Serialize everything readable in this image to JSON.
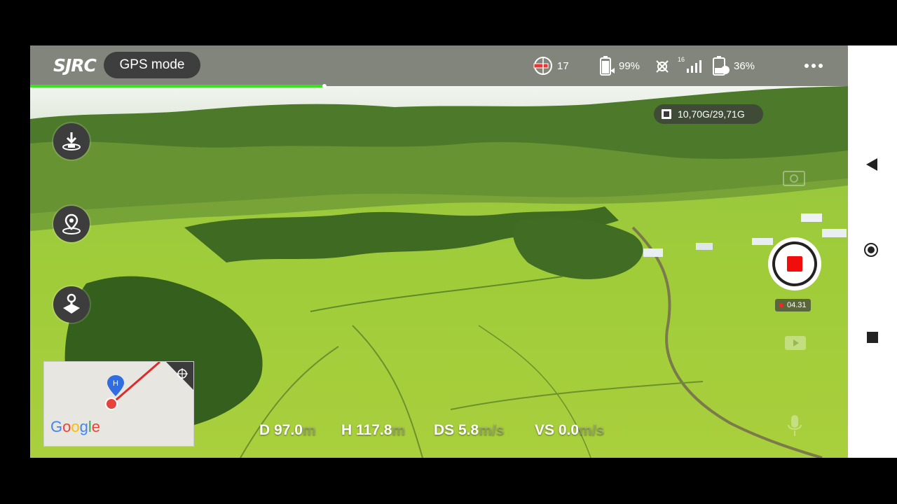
{
  "app": {
    "logo": "SJRC",
    "mode": "GPS mode"
  },
  "status": {
    "satellites": "17",
    "drone_battery": "99%",
    "signal_count": "16",
    "phone_battery": "36%"
  },
  "flight_progress": 0.36,
  "storage": "10,70G/29,71G",
  "side_buttons": [
    {
      "icon": "takeoff-landing-icon"
    },
    {
      "icon": "return-home-icon"
    },
    {
      "icon": "joystick-icon"
    }
  ],
  "minimap": {
    "brand": [
      "G",
      "o",
      "o",
      "g",
      "l",
      "e"
    ],
    "brand_colors": [
      "#4285F4",
      "#EA4335",
      "#FBBC05",
      "#4285F4",
      "#34A853",
      "#EA4335"
    ],
    "home_marker": "H"
  },
  "telemetry": {
    "distance_label": "D 97.0",
    "distance_unit": "m",
    "height_label": "H 117.8",
    "height_unit": "m",
    "ds_label": "DS 5.8",
    "ds_unit": "m/s",
    "vs_label": "VS 0.0",
    "vs_unit": "m/s"
  },
  "recording": {
    "time": "04.31"
  },
  "colors": {
    "accent_progress": "#3de023",
    "record_red": "#f20d0d",
    "topbar": "#808080"
  }
}
